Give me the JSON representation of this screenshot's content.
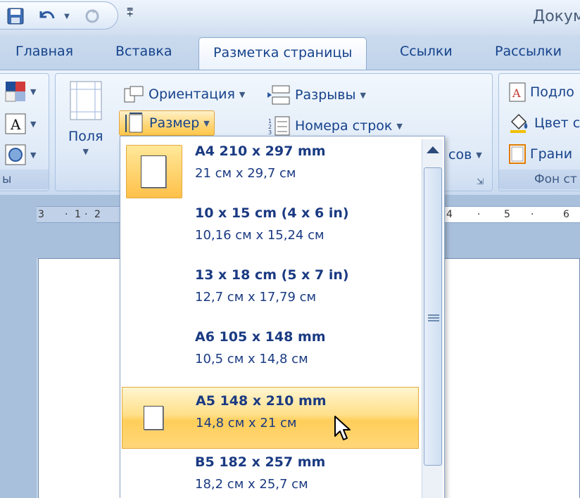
{
  "window": {
    "title": "Докум"
  },
  "quick_access": {
    "items": [
      "save-icon",
      "undo-icon",
      "redo-icon",
      "customize-qat-icon"
    ]
  },
  "tabs": [
    {
      "label": "Главная",
      "active": false
    },
    {
      "label": "Вставка",
      "active": false
    },
    {
      "label": "Разметка страницы",
      "active": true
    },
    {
      "label": "Ссылки",
      "active": false
    },
    {
      "label": "Рассылки",
      "active": false
    }
  ],
  "ribbon": {
    "themes_group_label": "ы",
    "page_setup": {
      "margins_label": "Поля",
      "orientation_label": "Ориентация",
      "size_label": "Размер",
      "breaks_label": "Разрывы",
      "line_numbers_label": "Номера строк",
      "hyphenation_partial": "сов"
    },
    "page_background": {
      "watermark_label": "Подло",
      "page_color_label": "Цвет с",
      "page_borders_label": "Грани",
      "group_label": "Фон ст"
    }
  },
  "ruler": {
    "left_marks": [
      "3",
      "·",
      "1",
      "·",
      "2"
    ],
    "right_marks": [
      "4",
      "·",
      "5",
      "·",
      "6"
    ]
  },
  "size_menu": {
    "items": [
      {
        "name": "A4 210 x 297 mm",
        "dims": "21 см x 29,7 см",
        "selected": true,
        "hover": false
      },
      {
        "name": "10 x 15 cm (4 x 6 in)",
        "dims": "10,16 см x 15,24 см",
        "selected": false,
        "hover": false
      },
      {
        "name": "13 x 18 cm (5 x 7 in)",
        "dims": "12,7 см x 17,79 см",
        "selected": false,
        "hover": false
      },
      {
        "name": "A6 105 x 148 mm",
        "dims": "10,5 см x 14,8 см",
        "selected": false,
        "hover": false
      },
      {
        "name": "A5 148 x 210 mm",
        "dims": "14,8 см x 21 см",
        "selected": false,
        "hover": true
      },
      {
        "name": "B5 182 x 257 mm",
        "dims": "18,2 см x 25,7 см",
        "selected": false,
        "hover": false
      }
    ]
  },
  "colors": {
    "accent": "#15428b",
    "hover": "#ffd77a",
    "hover_border": "#e3a93c"
  }
}
